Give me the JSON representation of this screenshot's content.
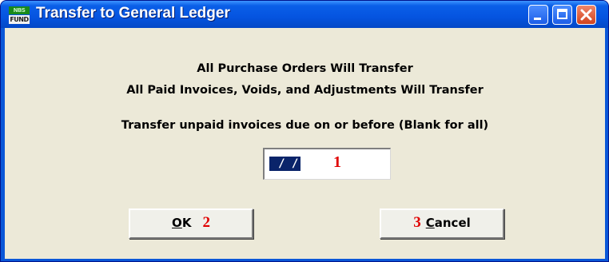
{
  "window": {
    "title": "Transfer to General Ledger",
    "app_icon": {
      "top_text": "NBS",
      "bottom_text": "FUND"
    }
  },
  "message": {
    "line1": "All Purchase Orders Will Transfer",
    "line2": "All Paid Invoices, Voids, and Adjustments Will Transfer",
    "prompt": "Transfer unpaid invoices due on or before (Blank for all)"
  },
  "date_field": {
    "value": " / /",
    "marker": "1"
  },
  "buttons": {
    "ok": {
      "accel": "O",
      "rest": "K",
      "marker": "2"
    },
    "cancel": {
      "marker": "3",
      "accel": "C",
      "rest": "ancel"
    }
  },
  "colors": {
    "title_bar": "#0554e0",
    "client_bg": "#ece9d8",
    "marker_red": "#e00000",
    "selection": "#0a246a"
  }
}
